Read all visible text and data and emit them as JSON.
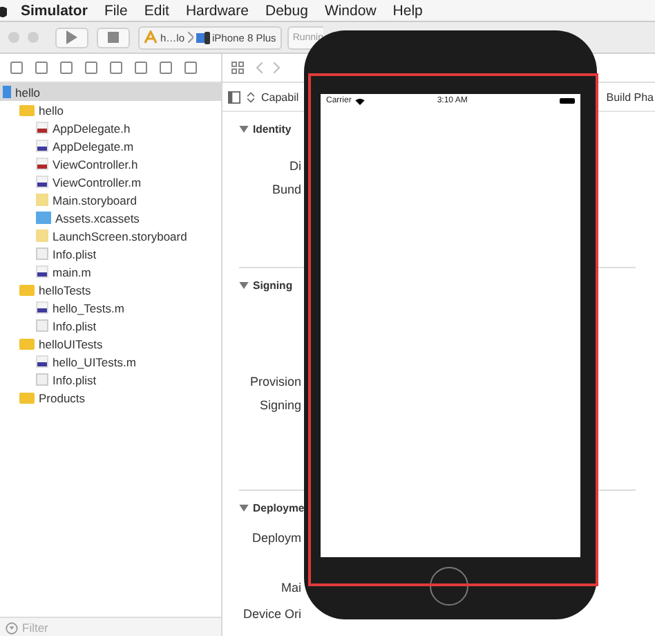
{
  "menu_bar": {
    "app": "Simulator",
    "items": [
      "File",
      "Edit",
      "Hardware",
      "Debug",
      "Window",
      "Help"
    ]
  },
  "toolbar": {
    "scheme": "h…lo",
    "device": "iPhone 8 Plus",
    "status": "Runnin"
  },
  "navigator": {
    "tree": [
      {
        "name": "hello",
        "kind": "project",
        "selected": true,
        "children": [
          {
            "name": "hello",
            "kind": "folder",
            "selected": false,
            "children": [
              {
                "name": "AppDelegate.h",
                "kind": "header",
                "selected": false
              },
              {
                "name": "AppDelegate.m",
                "kind": "source",
                "selected": false
              },
              {
                "name": "ViewController.h",
                "kind": "header",
                "selected": false
              },
              {
                "name": "ViewController.m",
                "kind": "source",
                "selected": false
              },
              {
                "name": "Main.storyboard",
                "kind": "storyboard",
                "selected": false
              },
              {
                "name": "Assets.xcassets",
                "kind": "assets",
                "selected": false
              },
              {
                "name": "LaunchScreen.storyboard",
                "kind": "storyboard",
                "selected": false
              },
              {
                "name": "Info.plist",
                "kind": "plist",
                "selected": false
              },
              {
                "name": "main.m",
                "kind": "source",
                "selected": false
              }
            ]
          },
          {
            "name": "helloTests",
            "kind": "folder",
            "selected": false,
            "children": [
              {
                "name": "hello_Tests.m",
                "kind": "source",
                "selected": false
              },
              {
                "name": "Info.plist",
                "kind": "plist",
                "selected": false
              }
            ]
          },
          {
            "name": "helloUITests",
            "kind": "folder",
            "selected": false,
            "children": [
              {
                "name": "hello_UITests.m",
                "kind": "source",
                "selected": false
              },
              {
                "name": "Info.plist",
                "kind": "plist",
                "selected": false
              }
            ]
          },
          {
            "name": "Products",
            "kind": "folder",
            "selected": false
          }
        ]
      }
    ],
    "filter_placeholder": "Filter"
  },
  "editor": {
    "tabs": [
      "Capabil",
      "Build Pha"
    ],
    "sections": [
      {
        "title": "Identity",
        "fields": [
          "Di",
          "Bund"
        ]
      },
      {
        "title": "Signing",
        "fields": [
          "Provision",
          "Signing"
        ]
      },
      {
        "title": "Deployme",
        "fields": [
          "Deploym",
          "Mai",
          "Device Ori"
        ]
      }
    ]
  },
  "simulator": {
    "carrier": "Carrier",
    "time": "3:10 AM"
  }
}
